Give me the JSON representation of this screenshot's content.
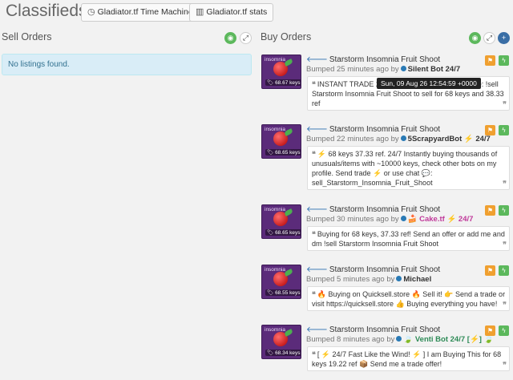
{
  "header": {
    "title": "Classifieds",
    "time_machine_label": "Gladiator.tf Time Machine",
    "stats_label": "Gladiator.tf stats"
  },
  "sell": {
    "title": "Sell Orders",
    "empty": "No listings found."
  },
  "buy": {
    "title": "Buy Orders"
  },
  "tooltip": "Sun, 09 Aug 26 12:54:59 +0000",
  "listings": [
    {
      "item": "Starstorm Insomnia Fruit Shoot",
      "thumb_name": "insomnia",
      "price": "68.67 keys",
      "bumped": "Bumped 25 minutes ago by",
      "user": "Silent Bot 24/7",
      "comment": "INSTANT TRADE 24/7 - Send offer or add and type: !sell Starstorm Insomnia Fruit Shoot to sell for 68 keys and 38.33 ref"
    },
    {
      "item": "Starstorm Insomnia Fruit Shoot",
      "thumb_name": "insomnia",
      "price": "68.65 keys",
      "bumped": "Bumped 22 minutes ago by",
      "user": "5ScrapyardBot ⚡ 24/7",
      "comment": "⚡ 68 keys 37.33 ref. 24/7 Instantly buying thousands of unusuals/items with ~10000 keys, check other bots on my profile. Send trade ⚡ or use chat 💬: sell_Starstorm_Insomnia_Fruit_Shoot"
    },
    {
      "item": "Starstorm Insomnia Fruit Shoot",
      "thumb_name": "insomnia",
      "price": "68.65 keys",
      "bumped": "Bumped 30 minutes ago by",
      "user": "🍰 Cake.tf ⚡ 24/7",
      "comment": "Buying for 68 keys, 37.33 ref! Send an offer or add me and dm !sell Starstorm Insomnia Fruit Shoot"
    },
    {
      "item": "Starstorm Insomnia Fruit Shoot",
      "thumb_name": "insomnia",
      "price": "68.55 keys",
      "bumped": "Bumped 5 minutes ago by",
      "user": "Michael",
      "comment": "🔥 Buying on Quicksell.store 🔥 Sell it! 👉 Send a trade or visit https://quicksell.store 👍 Buying everything you have!"
    },
    {
      "item": "Starstorm Insomnia Fruit Shoot",
      "thumb_name": "insomnia",
      "price": "68.34 keys",
      "bumped": "Bumped 8 minutes ago by",
      "user": "🍃 Venti Bot 24/7 [⚡] 🍃",
      "comment": "[ ⚡ 24/7 Fast Like the Wind! ⚡ ] I am Buying This for 68 keys 19.22 ref 📦 Send me a trade offer!"
    }
  ]
}
